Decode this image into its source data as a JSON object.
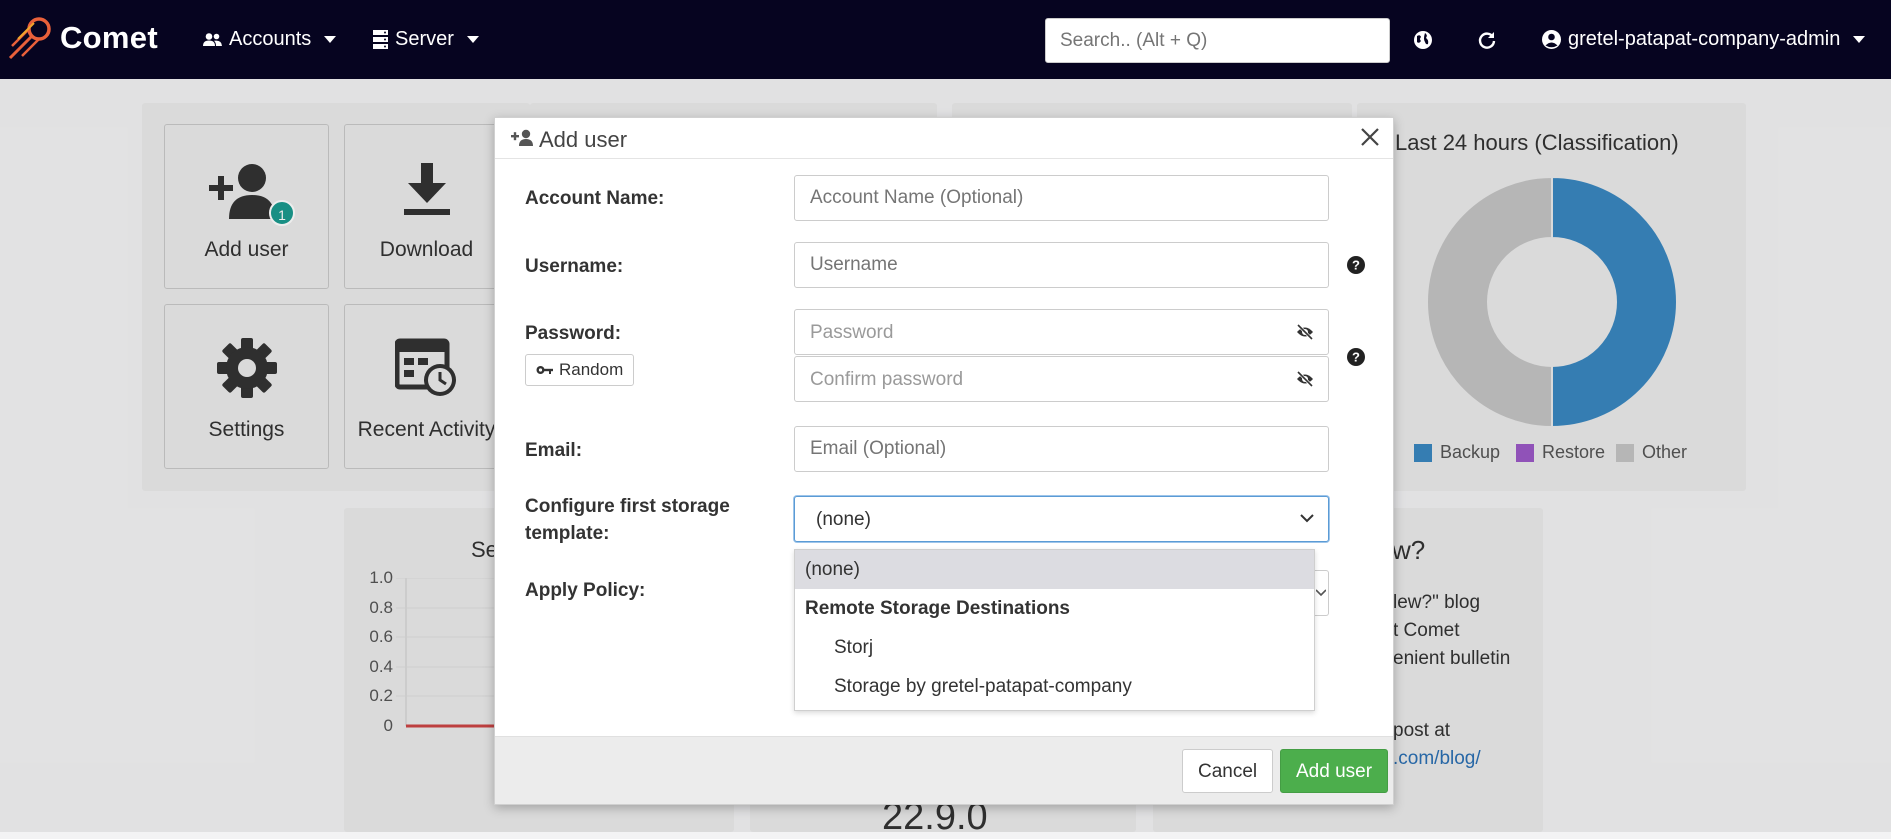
{
  "navbar": {
    "brand": "Comet",
    "accounts_label": "Accounts",
    "server_label": "Server",
    "search_placeholder": "Search.. (Alt + Q)",
    "user_label": "gretel-patapat-company-admin"
  },
  "dashboard": {
    "tiles": [
      {
        "label": "Add user",
        "icon": "add-user-icon",
        "badge": "1"
      },
      {
        "label": "Download",
        "icon": "download-icon"
      },
      {
        "label": "Settings",
        "icon": "gear-icon"
      },
      {
        "label": "Recent Activity",
        "icon": "calendar-clock-icon"
      }
    ],
    "chart_partial_title": "Se",
    "chart_yticks": [
      "1.0",
      "0.8",
      "0.6",
      "0.4",
      "0.2",
      "0"
    ],
    "version_partial": "22.9.0",
    "news_partial": {
      "title": "w?",
      "line1": "lew?\" blog",
      "line2": "t Comet",
      "line3": "enient bulletin",
      "line4": "post at",
      "link": ".com/blog/"
    }
  },
  "chart_data": {
    "type": "pie",
    "title": "Last 24 hours (Classification)",
    "donut": true,
    "series": [
      {
        "name": "Backup",
        "value": 50,
        "color": "#3a87c0"
      },
      {
        "name": "Restore",
        "value": 0,
        "color": "#9b59c6"
      },
      {
        "name": "Other",
        "value": 50,
        "color": "#c4c4c4"
      }
    ],
    "legend_position": "bottom"
  },
  "modal": {
    "title": "Add user",
    "fields": {
      "account_name": {
        "label": "Account Name:",
        "placeholder": "Account Name (Optional)"
      },
      "username": {
        "label": "Username:",
        "placeholder": "Username"
      },
      "password": {
        "label": "Password:",
        "placeholder": "Password",
        "confirm_placeholder": "Confirm password",
        "random_label": "Random"
      },
      "email": {
        "label": "Email:",
        "placeholder": "Email (Optional)"
      },
      "storage_template": {
        "label_line1": "Configure first storage",
        "label_line2": "template:",
        "selected": "(none)",
        "options": {
          "none": "(none)",
          "group": "Remote Storage Destinations",
          "item1": "Storj",
          "item2": "Storage by gretel-patapat-company"
        }
      },
      "apply_policy": {
        "label": "Apply Policy:"
      }
    },
    "buttons": {
      "cancel": "Cancel",
      "add": "Add user"
    }
  }
}
